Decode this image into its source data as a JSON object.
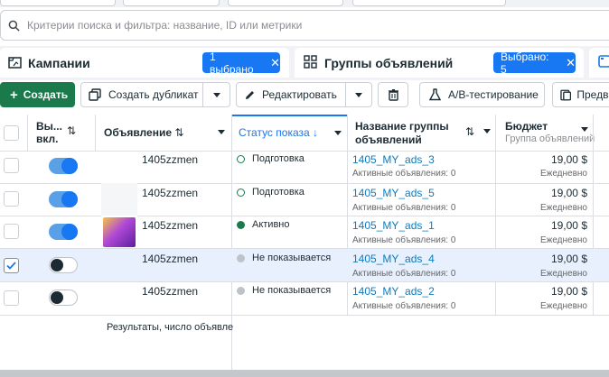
{
  "search": {
    "placeholder": "Критерии поиска и фильтра: название, ID или метрики"
  },
  "tabs": {
    "campaigns": {
      "label": "Кампании",
      "badge": "1 выбрано"
    },
    "adsets": {
      "label": "Группы объявлений",
      "badge": "Выбрано: 5"
    }
  },
  "toolbar": {
    "create": "Создать",
    "duplicate": "Создать дубликат",
    "edit": "Редактировать",
    "ab_test": "A/B-тестирование",
    "preview": "Предва"
  },
  "columns": {
    "onoff": [
      "Вы...",
      "вкл."
    ],
    "ad": "Объявление",
    "status": "Статус показа",
    "adset_name": [
      "Название группы",
      "объявлений"
    ],
    "budget": "Бюджет",
    "budget_sub": "Группа объявлений"
  },
  "rows": [
    {
      "name": "1405zzmen",
      "status": "Подготовка",
      "adset": "1405_MY_ads_3",
      "adset_sub": "Активные объявления: 0",
      "budget": "19,00 $",
      "budget_sub": "Ежедневно"
    },
    {
      "name": "1405zzmen",
      "status": "Подготовка",
      "adset": "1405_MY_ads_5",
      "adset_sub": "Активные объявления: 0",
      "budget": "19,00 $",
      "budget_sub": "Ежедневно"
    },
    {
      "name": "1405zzmen",
      "status": "Активно",
      "adset": "1405_MY_ads_1",
      "adset_sub": "Активные объявления: 0",
      "budget": "19,00 $",
      "budget_sub": "Ежедневно"
    },
    {
      "name": "1405zzmen",
      "status": "Не показывается",
      "adset": "1405_MY_ads_4",
      "adset_sub": "Активные объявления: 0",
      "budget": "19,00 $",
      "budget_sub": "Ежедневно"
    },
    {
      "name": "1405zzmen",
      "status": "Не показывается",
      "adset": "1405_MY_ads_2",
      "adset_sub": "Активные объявления: 0",
      "budget": "19,00 $",
      "budget_sub": "Ежедневно"
    }
  ],
  "footer": "Результаты, число объявле"
}
